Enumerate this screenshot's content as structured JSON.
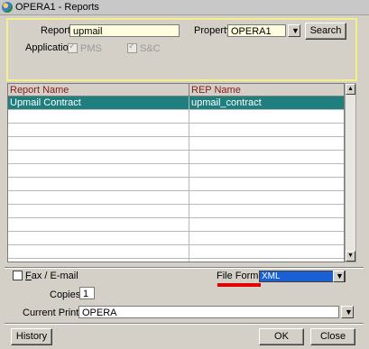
{
  "window": {
    "title": "OPERA1 - Reports"
  },
  "filters": {
    "report_label": "Report",
    "report_value": "upmail",
    "property_label": "Property",
    "property_value": "OPERA1",
    "search_label": "Search",
    "application_label": "Application",
    "app_pms_label": "PMS",
    "app_sc_label": "S&C"
  },
  "grid": {
    "columns": [
      "Report Name",
      "REP Name"
    ],
    "rows": [
      {
        "report_name": "Upmail Contract",
        "rep_name": "upmail_contract",
        "selected": true
      }
    ],
    "empty_rows": 11
  },
  "options": {
    "fax_email_label": "Fax / E-mail",
    "file_format_label": "File Format",
    "file_format_value": "XML",
    "copies_label": "Copies",
    "copies_value": "1",
    "printer_label": "Current Printer",
    "printer_value": "OPERA"
  },
  "buttons": {
    "history_label": "History",
    "ok_label": "OK",
    "close_label": "Close"
  },
  "colors": {
    "selected_row": "#1f7f7f",
    "highlight_panel": "#f3f08c",
    "annotation_underline": "#e30000",
    "dropdown_selection": "#1a5fd4"
  }
}
